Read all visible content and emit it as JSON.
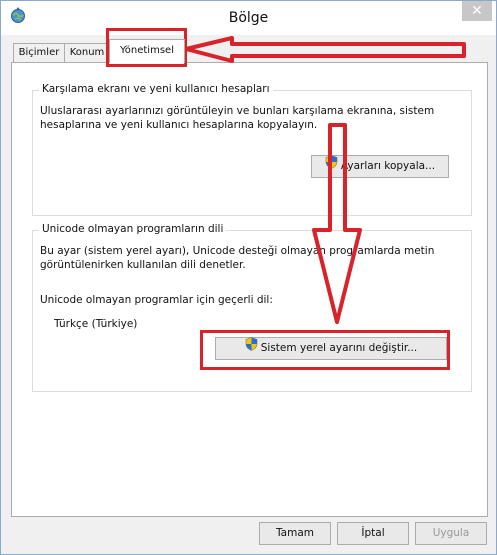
{
  "window": {
    "title": "Bölge",
    "close_glyph": "✕"
  },
  "tabs": [
    {
      "label": "Biçimler"
    },
    {
      "label": "Konum"
    },
    {
      "label": "Yönetimsel"
    }
  ],
  "welcome_group": {
    "title": "Karşılama ekranı ve yeni kullanıcı hesapları",
    "line1": "Uluslararası ayarlarınızı görüntüleyin ve bunları karşılama ekranına, sistem",
    "line2": "hesaplarına ve yeni kullanıcı hesaplarına kopyalayın.",
    "copy_button": "Ayarları kopyala..."
  },
  "unicode_group": {
    "title": "Unicode olmayan programların dili",
    "line1": "Bu ayar (sistem yerel ayarı), Unicode desteği olmayan programlarda metin",
    "line2": "görüntülenirken kullanılan dili denetler.",
    "current_label": "Unicode olmayan programlar için geçerli dil:",
    "current_value": "Türkçe (Türkiye)",
    "change_button": "Sistem yerel ayarını değiştir..."
  },
  "footer": {
    "ok": "Tamam",
    "cancel": "İptal",
    "apply": "Uygula"
  },
  "icons": {
    "app": "region-globe-icon",
    "shield": "uac-shield-icon"
  },
  "colors": {
    "annotation": "#d8232a",
    "accent": "#8aa9cf"
  }
}
